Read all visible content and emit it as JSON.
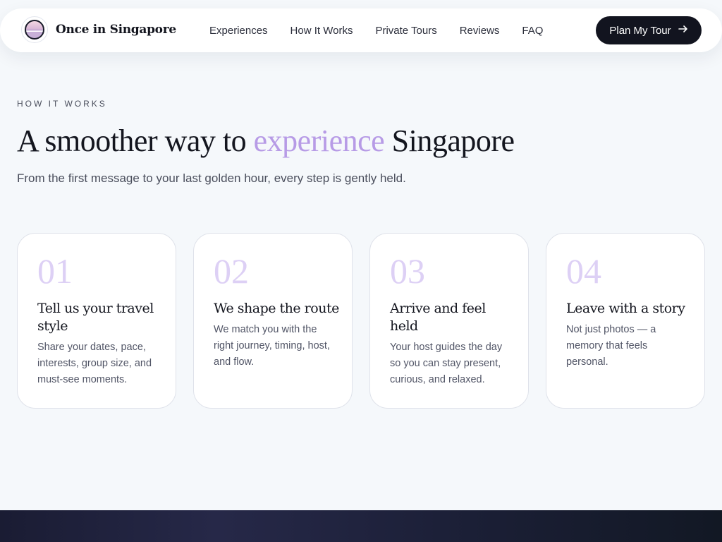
{
  "brand": {
    "name": "Once in Singapore",
    "logo": "sunset-logo-icon"
  },
  "nav": {
    "links": [
      "Experiences",
      "How It Works",
      "Private Tours",
      "Reviews",
      "FAQ"
    ],
    "cta_label": "Plan My Tour",
    "cta_icon": "arrow-right-icon"
  },
  "section": {
    "eyebrow": "HOW IT WORKS",
    "headline_before": "A smoother way to ",
    "headline_accent": "experience",
    "headline_after": " Singapore",
    "subtitle": "From the first message to your last golden hour, every step is gently held."
  },
  "steps": [
    {
      "num": "01",
      "title": "Tell us your travel style",
      "text": "Share your dates, pace, interests, group size, and must-see moments."
    },
    {
      "num": "02",
      "title": "We shape the route",
      "text": "We match you with the right journey, timing, host, and flow."
    },
    {
      "num": "03",
      "title": "Arrive and feel held",
      "text": "Your host guides the day so you can stay present, curious, and relaxed."
    },
    {
      "num": "04",
      "title": "Leave with a story",
      "text": "Not just photos — a memory that feels personal."
    }
  ],
  "colors": {
    "accent": "#b79be6",
    "dark": "#12141f",
    "background": "#f5f8fb"
  }
}
